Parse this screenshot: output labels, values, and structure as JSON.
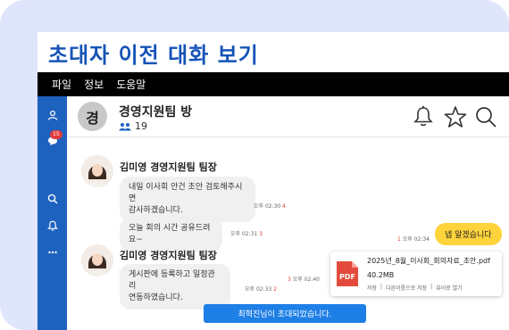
{
  "page_title": "초대자 이전 대화 보기",
  "menu": [
    "파일",
    "정보",
    "도움말"
  ],
  "sidebar": {
    "icons": [
      "person-icon",
      "chat-icon",
      "search-icon",
      "bell-icon",
      "more-icon"
    ],
    "chat_badge": "15"
  },
  "room": {
    "avatar_text": "경",
    "name": "경영지원팀 방",
    "member_count": "19"
  },
  "messages": {
    "m1": {
      "sender": "김미영 경영지원팀 팀장",
      "text_line1": "내일 이사회 안건 초안 검토해주시면",
      "text_line2": "감사하겠습니다.",
      "time": "오후 02:30",
      "unread": "4"
    },
    "m2": {
      "text": "오늘 회의 시간 공유드려요~",
      "time": "오후 02:31",
      "unread": "3"
    },
    "m3": {
      "text": "넵 알겠습니다",
      "time": "오후 02:34",
      "unread": "1"
    },
    "m4": {
      "sender": "김미영 경영지원팀 팀장",
      "text_line1": "게시판에 등록하고 일정관리",
      "text_line2": "연동하였습니다.",
      "time": "오후 02:33",
      "unread": "2"
    },
    "m5": {
      "time": "오후 02:40",
      "unread": "3"
    }
  },
  "file": {
    "name": "2025년_8월_이사회_회의자료_초안.pdf",
    "size": "40.2MB",
    "actions": [
      "저장",
      "다른이름으로 저장",
      "뷰어로 열기"
    ],
    "separator": "|"
  },
  "notice": "최혁진님이 초대되었습니다.",
  "colors": {
    "accent": "#1e62bf",
    "title": "#1653b8",
    "my_bubble": "#ffd33c",
    "notice": "#1e7fe6",
    "unread": "#e0412e"
  }
}
